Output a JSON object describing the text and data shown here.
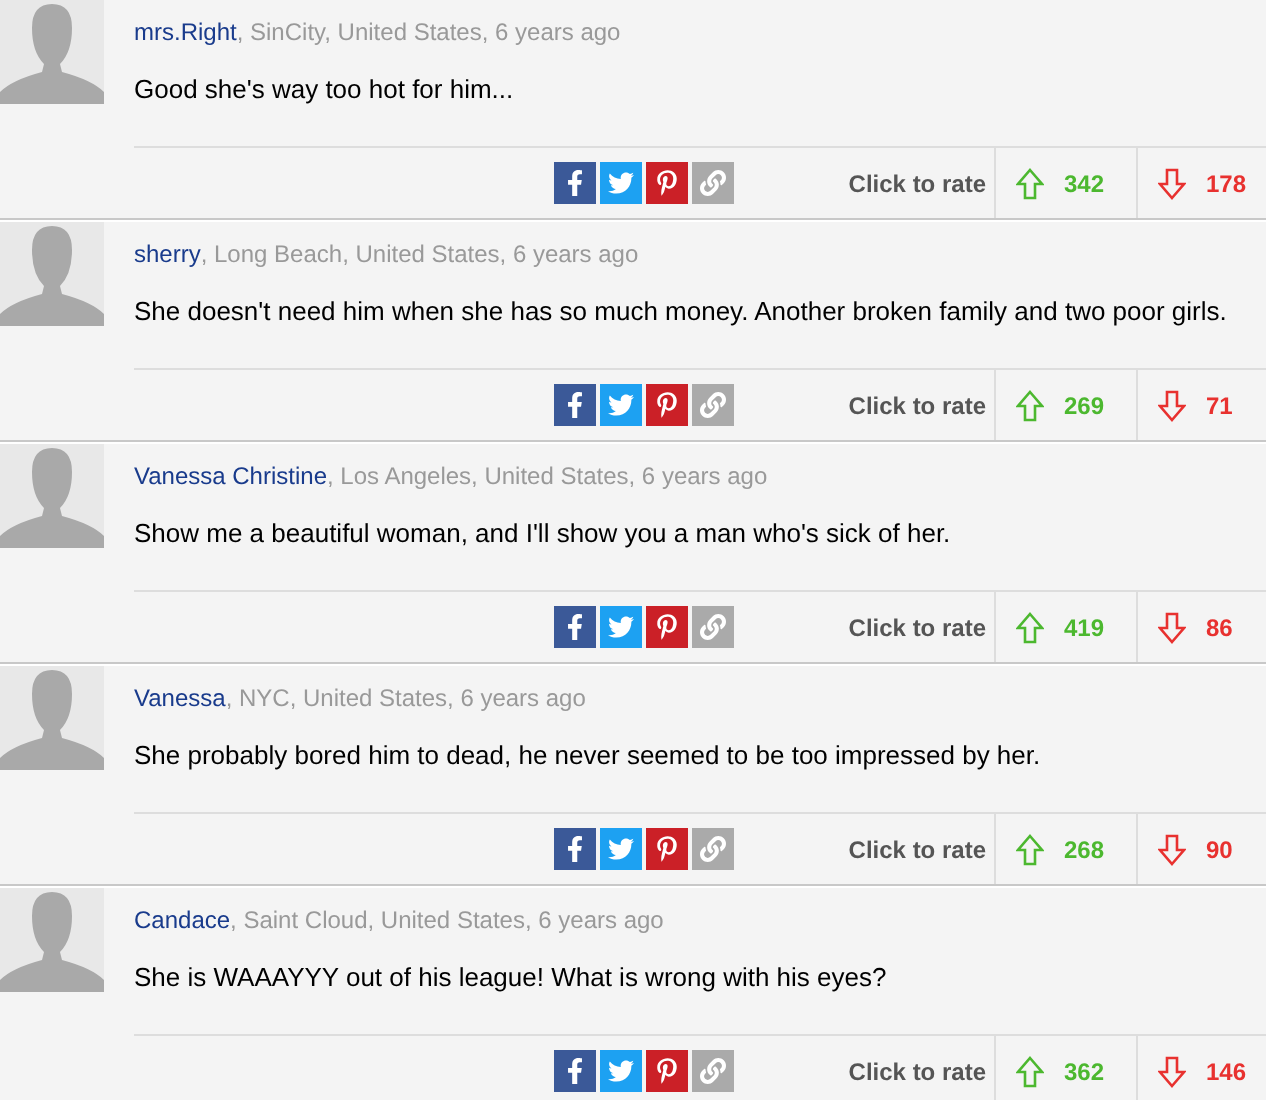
{
  "comments": [
    {
      "author": "mrs.Right",
      "meta": ", SinCity, United States, 6 years ago",
      "text": "Good she's way too hot for him...",
      "rate_label": "Click to rate",
      "up": "342",
      "down": "178"
    },
    {
      "author": "sherry",
      "meta": ", Long Beach, United States, 6 years ago",
      "text": "She doesn't need him when she has so much money. Another broken family and two poor girls.",
      "rate_label": "Click to rate",
      "up": "269",
      "down": "71"
    },
    {
      "author": "Vanessa Christine",
      "meta": ", Los Angeles, United States, 6 years ago",
      "text": "Show me a beautiful woman, and I'll show you a man who's sick of her.",
      "rate_label": "Click to rate",
      "up": "419",
      "down": "86"
    },
    {
      "author": "Vanessa",
      "meta": ", NYC, United States, 6 years ago",
      "text": "She probably bored him to dead, he never seemed to be too impressed by her.",
      "rate_label": "Click to rate",
      "up": "268",
      "down": "90"
    },
    {
      "author": "Candace",
      "meta": ", Saint Cloud, United States, 6 years ago",
      "text": "She is WAAAYYY out of his league! What is wrong with his eyes?",
      "rate_label": "Click to rate",
      "up": "362",
      "down": "146"
    }
  ]
}
